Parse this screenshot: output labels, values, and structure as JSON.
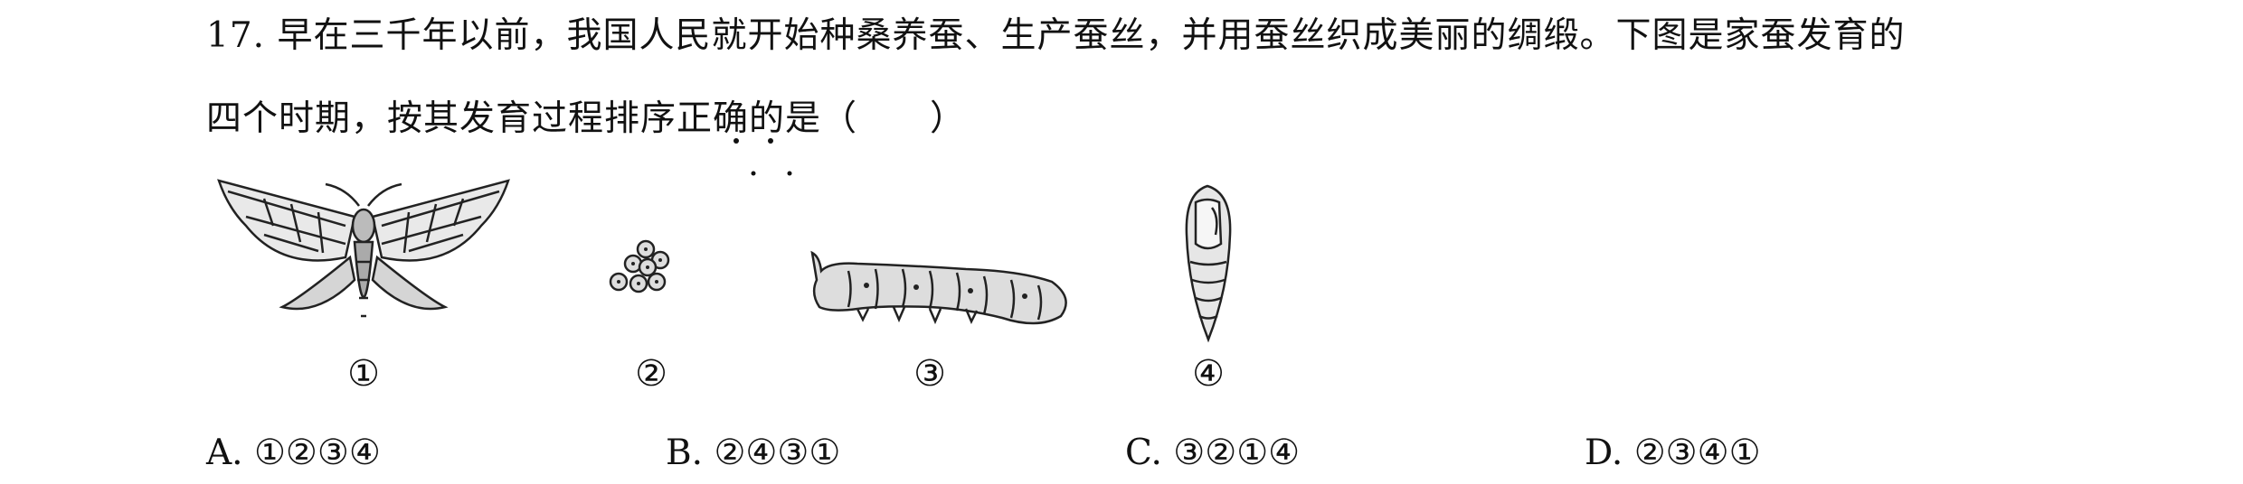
{
  "question": {
    "number": "17.",
    "line1": "早在三千年以前，我国人民就开始种桑养蚕、生产蚕丝，并用蚕丝织成美丽的绸缎。下图是家蚕发育的",
    "line2": "四个时期，按其发育过程排序正确的是（　　）"
  },
  "figures": [
    {
      "label": "①",
      "icon": "moth-icon"
    },
    {
      "label": "②",
      "icon": "eggs-icon"
    },
    {
      "label": "③",
      "icon": "larva-icon"
    },
    {
      "label": "④",
      "icon": "pupa-icon"
    }
  ],
  "options": [
    {
      "letter": "A.",
      "text": "①②③④"
    },
    {
      "letter": "B.",
      "text": "②④③①"
    },
    {
      "letter": "C.",
      "text": "③②①④"
    },
    {
      "letter": "D.",
      "text": "②③④①"
    }
  ]
}
